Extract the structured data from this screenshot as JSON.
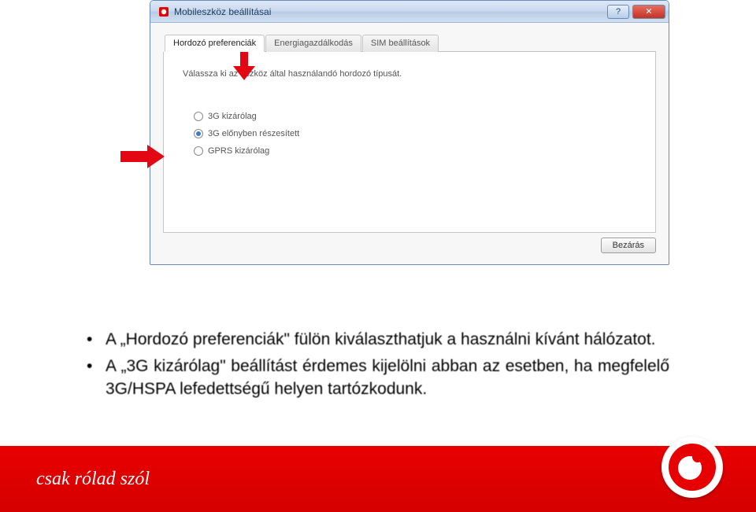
{
  "dialog": {
    "title": "Mobileszköz beállításai",
    "tabs": [
      {
        "label": "Hordozó preferenciák",
        "active": true
      },
      {
        "label": "Energiagazdálkodás",
        "active": false
      },
      {
        "label": "SIM beállítások",
        "active": false
      }
    ],
    "instruction": "Válassza ki az eszköz által használandó hordozó típusát.",
    "options": [
      {
        "label": "3G kizárólag",
        "checked": false
      },
      {
        "label": "3G előnyben részesített",
        "checked": true
      },
      {
        "label": "GPRS kizárólag",
        "checked": false
      }
    ],
    "close_button": "Bezárás",
    "help_button": "?",
    "x_button": "✕"
  },
  "bullets": {
    "item1": "A „Hordozó preferenciák\" fülön kiválaszthatjuk a használni kívánt hálózatot.",
    "item2": "A „3G kizárólag\" beállítást érdemes kijelölni abban az esetben, ha megfelelő 3G/HSPA lefedettségű helyen tartózkodunk."
  },
  "footer": {
    "slogan": "csak rólad szól"
  },
  "icons": {
    "help": "help-icon",
    "close": "close-icon",
    "app": "app-icon",
    "arrow_down": "arrow-down-icon",
    "arrow_right": "arrow-right-icon",
    "logo": "vodafone-logo"
  }
}
